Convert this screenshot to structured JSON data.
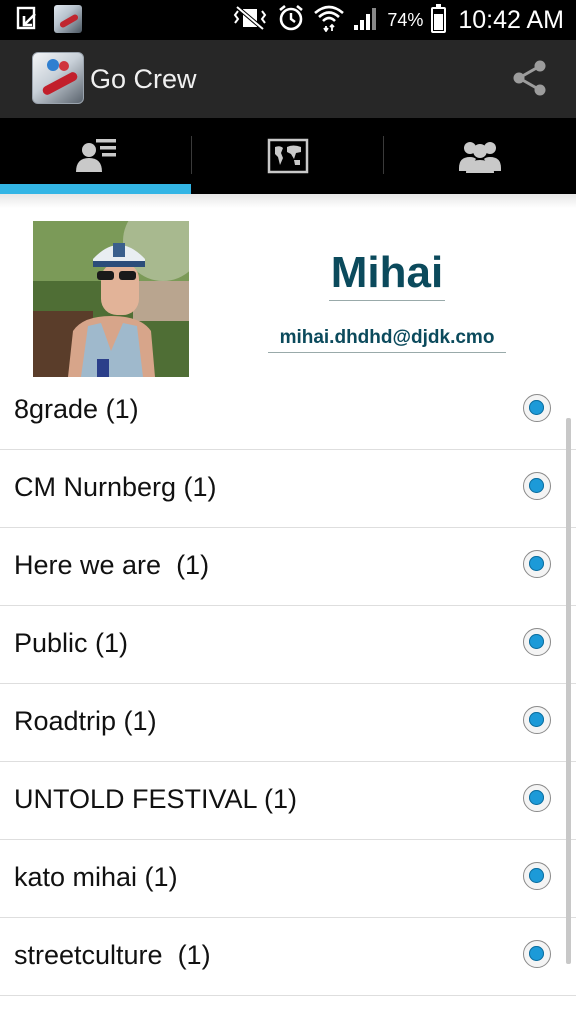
{
  "status_bar": {
    "battery_percent": "74%",
    "time": "10:42 AM",
    "battery_level": 0.74,
    "icons": [
      "download-done-icon",
      "app-notification-icon",
      "vibrate-mute-icon",
      "alarm-icon",
      "wifi-icon",
      "signal-icon",
      "battery-icon"
    ]
  },
  "action_bar": {
    "title": "Go Crew",
    "share_icon": "share-icon"
  },
  "tabs": [
    {
      "icon": "profile-list-icon",
      "selected": true
    },
    {
      "icon": "world-map-icon",
      "selected": false
    },
    {
      "icon": "group-icon",
      "selected": false
    }
  ],
  "profile": {
    "name": "Mihai",
    "email": "mihai.dhdhd@djdk.cmo"
  },
  "groups": [
    {
      "label": "8grade (1)",
      "selected": true
    },
    {
      "label": "CM Nurnberg (1)",
      "selected": true
    },
    {
      "label": "Here we are  (1)",
      "selected": true
    },
    {
      "label": "Public (1)",
      "selected": true
    },
    {
      "label": "Roadtrip (1)",
      "selected": true
    },
    {
      "label": "UNTOLD FESTIVAL (1)",
      "selected": true
    },
    {
      "label": "kato mihai (1)",
      "selected": true
    },
    {
      "label": "streetculture  (1)",
      "selected": true
    }
  ],
  "colors": {
    "accent": "#33b5e5",
    "name_text": "#0b4a5c",
    "action_bar": "#272727",
    "radio_fill": "#1c9ad8"
  }
}
